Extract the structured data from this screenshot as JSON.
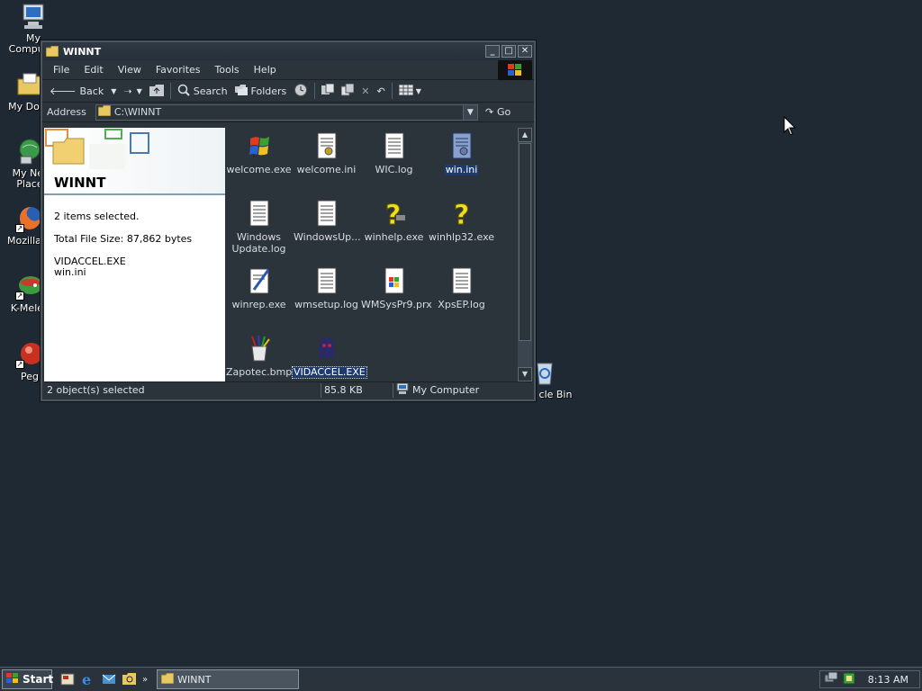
{
  "desktop": {
    "icons": [
      {
        "label": "My Computer",
        "icon": "computer-icon"
      },
      {
        "label": "My Docu",
        "icon": "documents-folder-icon"
      },
      {
        "label": "My Net",
        "label2": "Place",
        "icon": "network-places-icon"
      },
      {
        "label": "Mozilla Fi",
        "icon": "firefox-icon"
      },
      {
        "label": "K-Melec",
        "icon": "k-meleon-icon"
      },
      {
        "label": "Peg",
        "icon": "pegasus-icon"
      },
      {
        "label": "cle Bin",
        "icon": "recycle-bin-icon"
      }
    ]
  },
  "window": {
    "title": "WINNT",
    "menu": [
      "File",
      "Edit",
      "View",
      "Favorites",
      "Tools",
      "Help"
    ],
    "toolbar": {
      "back": "Back",
      "search": "Search",
      "folders": "Folders"
    },
    "address": {
      "label": "Address",
      "value": "C:\\WINNT",
      "go": "Go"
    },
    "left_pane": {
      "title": "WINNT",
      "selected_count": "2 items selected.",
      "total_size": "Total File Size: 87,862 bytes",
      "file1": "VIDACCEL.EXE",
      "file2": "win.ini"
    },
    "files": [
      {
        "name": "welcome.exe",
        "icon": "windows-logo-exe-icon"
      },
      {
        "name": "welcome.ini",
        "icon": "ini-file-icon"
      },
      {
        "name": "WIC.log",
        "icon": "text-file-icon"
      },
      {
        "name": "win.ini",
        "icon": "ini-file-icon"
      },
      {
        "name": "Windows",
        "name2": "Update.log",
        "icon": "text-file-icon"
      },
      {
        "name": "WindowsUp...",
        "icon": "text-file-icon"
      },
      {
        "name": "winhelp.exe",
        "icon": "help-question-icon"
      },
      {
        "name": "winhlp32.exe",
        "icon": "help-question-icon"
      },
      {
        "name": "winrep.exe",
        "icon": "report-editor-icon"
      },
      {
        "name": "wmsetup.log",
        "icon": "text-file-icon"
      },
      {
        "name": "WMSysPr9.prx",
        "icon": "media-file-icon"
      },
      {
        "name": "XpsEP.log",
        "icon": "text-file-icon"
      },
      {
        "name": "Zapotec.bmp",
        "icon": "paint-bitmap-icon"
      },
      {
        "name": "VIDACCEL.EXE",
        "icon": "ghost-exe-icon"
      }
    ],
    "status": {
      "objects": "2 object(s) selected",
      "size": "85.8 KB",
      "location": "My Computer"
    }
  },
  "taskbar": {
    "start": "Start",
    "task": "WINNT",
    "clock": "8:13 AM"
  },
  "colors": {
    "desktop": "#1f2933",
    "selection": "#1e3a6e",
    "window_bg": "#2b333b"
  }
}
